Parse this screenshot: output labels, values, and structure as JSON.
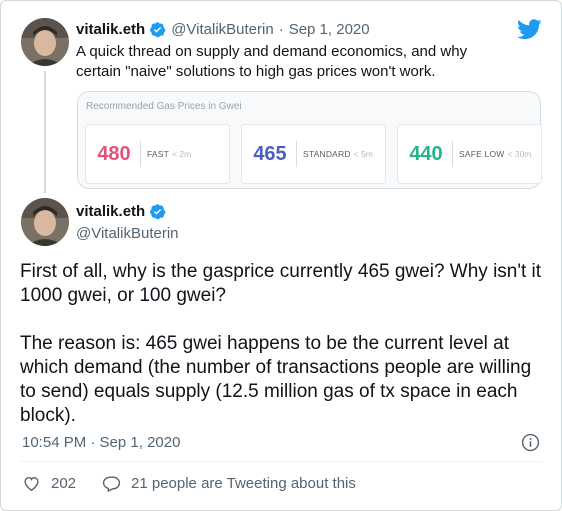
{
  "reply_tweet": {
    "author_name": "vitalik.eth",
    "author_handle": "@VitalikButerin",
    "separator": "·",
    "date": "Sep 1, 2020",
    "text": "A quick thread on supply and demand economics, and why certain \"naive\" solutions to high gas prices won't work.",
    "card": {
      "title": "Recommended Gas Prices in Gwei",
      "prices": [
        {
          "value": "480",
          "label": "FAST",
          "time": "< 2m",
          "color": "#e3517d"
        },
        {
          "value": "465",
          "label": "STANDARD",
          "time": "< 5m",
          "color": "#4c5fbf"
        },
        {
          "value": "440",
          "label": "SAFE LOW",
          "time": "< 30m",
          "color": "#24b38a"
        }
      ]
    }
  },
  "main_tweet": {
    "author_name": "vitalik.eth",
    "author_handle": "@VitalikButerin",
    "paragraph_1": "First of all, why is the gasprice currently 465 gwei? Why isn't it 1000 gwei, or 100 gwei?",
    "paragraph_2": "The reason is: 465 gwei happens to be the current level at which demand (the number of transactions people are willing to send) equals supply (12.5 million gas of tx space in each block).",
    "timestamp": "10:54 PM · Sep 1, 2020",
    "likes": "202",
    "replies_text": "21 people are Tweeting about this"
  },
  "icons": {
    "logo": "twitter-bird-icon",
    "verified": "verified-badge-icon",
    "info": "info-icon",
    "like": "heart-icon",
    "reply": "speech-bubble-icon"
  },
  "colors": {
    "twitter_blue": "#1d9bf0",
    "text_secondary": "#536471"
  }
}
